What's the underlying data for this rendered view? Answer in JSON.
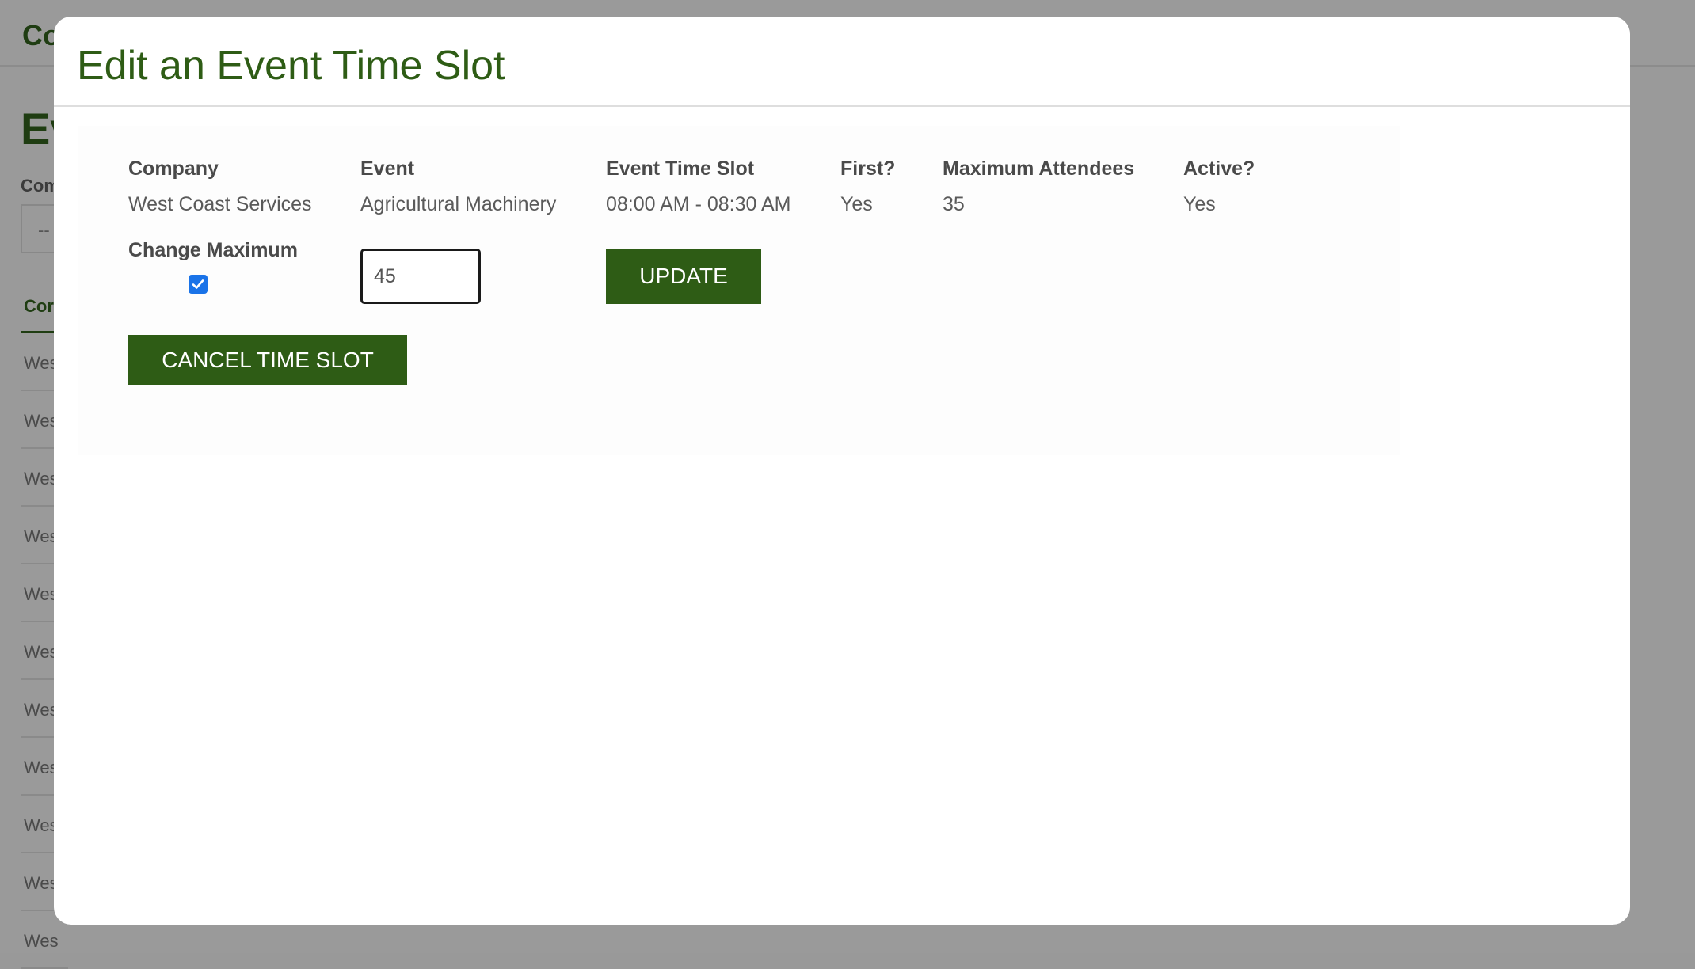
{
  "background": {
    "brand": "Co",
    "heading": "Ev",
    "filter_label": "Com",
    "select_value": "--",
    "column_header": "Cor",
    "rows": [
      "Wes",
      "Wes",
      "Wes",
      "Wes",
      "Wes",
      "Wes",
      "Wes",
      "Wes",
      "Wes",
      "Wes",
      "Wes"
    ]
  },
  "modal": {
    "title": "Edit an Event Time Slot",
    "columns": {
      "company": {
        "label": "Company",
        "value": "West Coast Services"
      },
      "event": {
        "label": "Event",
        "value": "Agricultural Machinery"
      },
      "time_slot": {
        "label": "Event Time Slot",
        "value": "08:00 AM - 08:30 AM"
      },
      "first": {
        "label": "First?",
        "value": "Yes"
      },
      "max_attendees": {
        "label": "Maximum Attendees",
        "value": "35"
      },
      "active": {
        "label": "Active?",
        "value": "Yes"
      }
    },
    "change_maximum": {
      "label": "Change Maximum",
      "checked": true,
      "input_value": "45"
    },
    "update_button": "UPDATE",
    "cancel_button": "CANCEL TIME SLOT"
  },
  "colors": {
    "accent": "#2e5c15",
    "overlay": "#999999",
    "checkbox": "#1a73e8"
  }
}
